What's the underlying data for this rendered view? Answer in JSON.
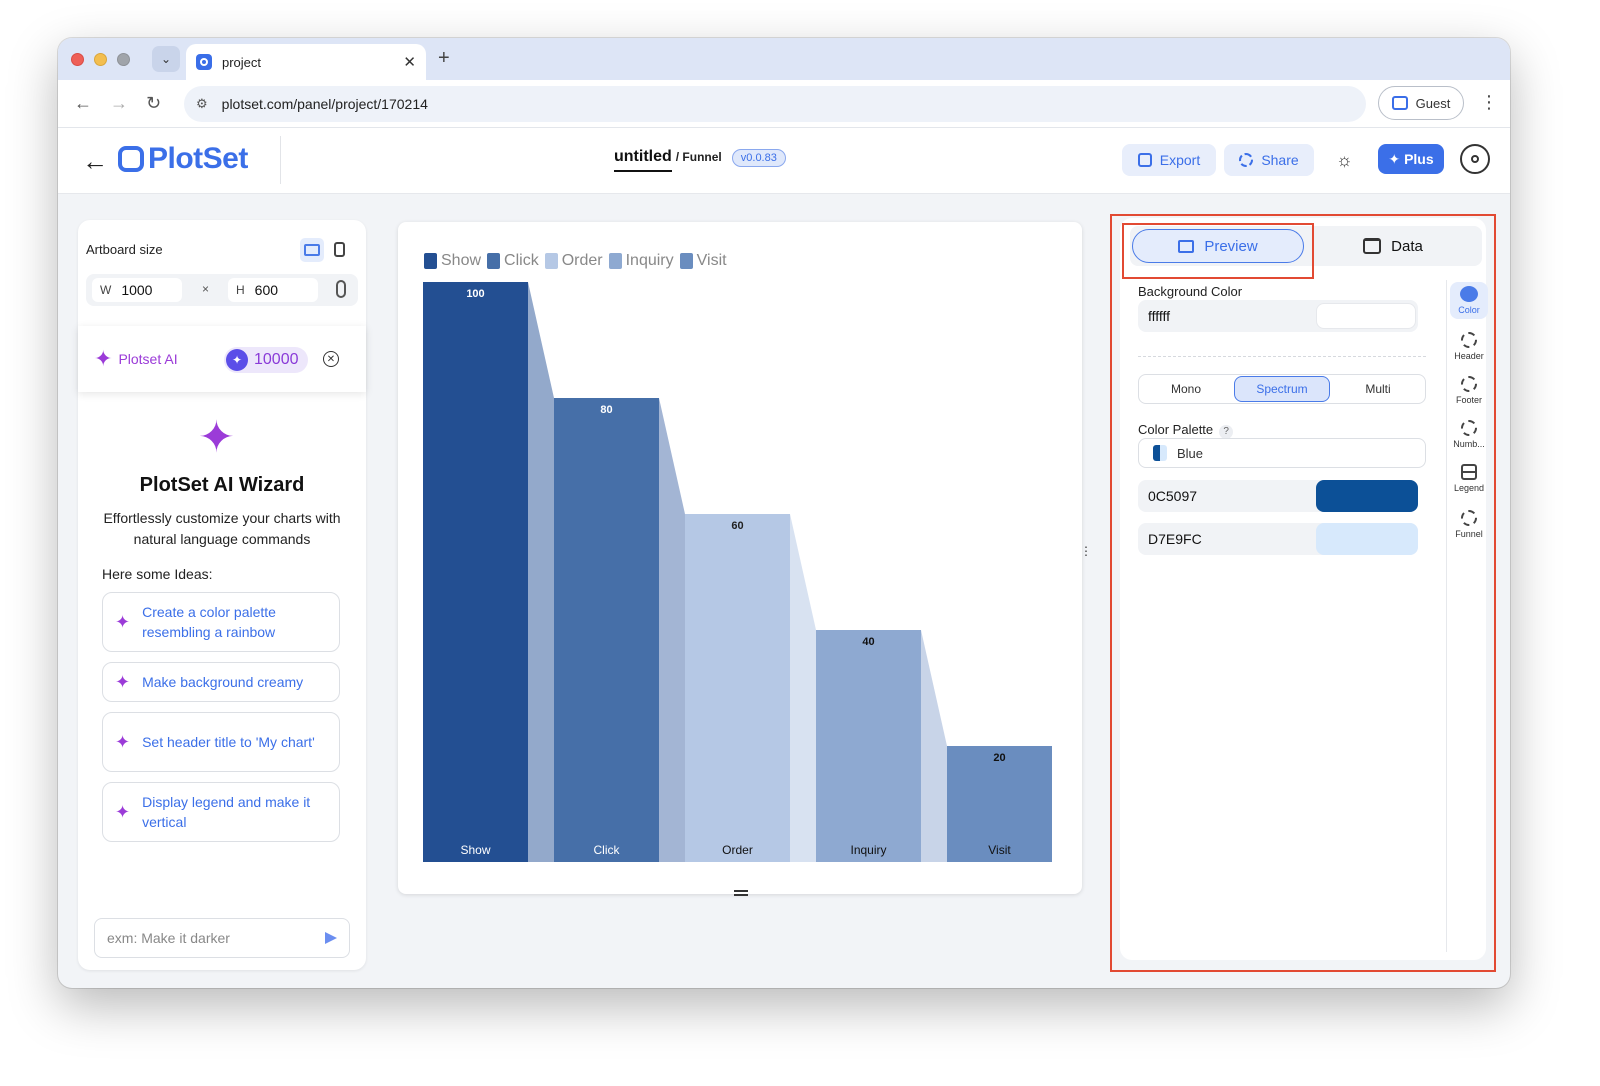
{
  "browser": {
    "tab_title": "project",
    "url": "plotset.com/panel/project/170214",
    "profile_label": "Guest"
  },
  "header": {
    "logo_text": "PlotSet",
    "project_name": "untitled",
    "chart_type": "/ Funnel",
    "version": "v0.0.83",
    "export_label": "Export",
    "share_label": "Share",
    "plus_label": "Plus"
  },
  "artboard": {
    "label": "Artboard size",
    "width_key": "W",
    "width_value": "1000",
    "times": "×",
    "height_key": "H",
    "height_value": "600"
  },
  "ai": {
    "name": "Plotset AI",
    "credits": "10000",
    "wizard_title": "PlotSet AI Wizard",
    "wizard_subtitle": "Effortlessly customize your charts with natural language commands",
    "ideas_label": "Here some Ideas:",
    "ideas": [
      "Create a color palette resembling a rainbow",
      "Make background creamy",
      "Set header title to 'My chart'",
      "Display legend and make it vertical"
    ],
    "input_placeholder": "exm: Make it darker"
  },
  "chart_data": {
    "type": "bar",
    "subtype": "funnel",
    "categories": [
      "Show",
      "Click",
      "Order",
      "Inquiry",
      "Visit"
    ],
    "values": [
      100,
      80,
      60,
      40,
      20
    ],
    "legend": [
      "Show",
      "Click",
      "Order",
      "Inquiry",
      "Visit"
    ],
    "legend_position": "top-left",
    "colors": [
      "#234F92",
      "#466FA8",
      "#B5C8E5",
      "#8EA9D1",
      "#6A8DBF"
    ],
    "connector_colors": [
      "#93A9CB",
      "#A3B5D4",
      "#D8E2F1",
      "#C8D4E8"
    ],
    "ylim": [
      0,
      100
    ],
    "grid": false
  },
  "settings": {
    "tab_preview": "Preview",
    "tab_data": "Data",
    "bg_color_label": "Background Color",
    "bg_color_value": "ffffff",
    "bg_color": "#ffffff",
    "modes": [
      "Mono",
      "Spectrum",
      "Multi"
    ],
    "active_mode": "Spectrum",
    "palette_label": "Color Palette",
    "palette_help": "?",
    "palette_name": "Blue",
    "colors": [
      {
        "hex": "0C5097",
        "color": "#0C5097"
      },
      {
        "hex": "D7E9FC",
        "color": "#D7E9FC"
      }
    ],
    "sidebar": [
      "Color",
      "Header",
      "Footer",
      "Numb...",
      "Legend",
      "Funnel"
    ]
  }
}
